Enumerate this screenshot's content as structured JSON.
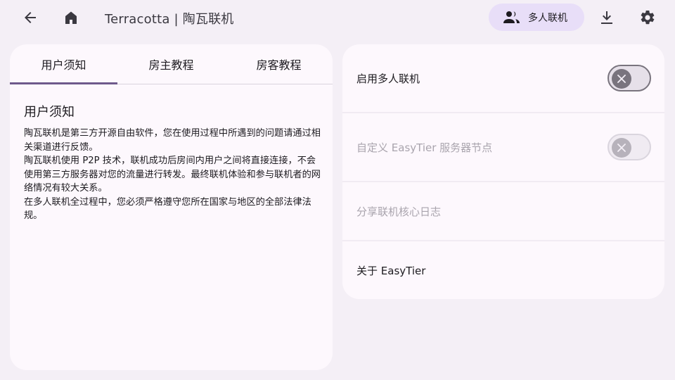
{
  "app": {
    "title": "Terracotta | 陶瓦联机"
  },
  "toolbar": {
    "back_icon": "arrow-left-icon",
    "home_icon": "home-icon",
    "multiplayer_chip_label": "多人联机",
    "multiplayer_chip_icon": "people-icon",
    "download_icon": "download-icon",
    "settings_icon": "gear-icon"
  },
  "tabs": [
    {
      "label": "用户须知",
      "active": true
    },
    {
      "label": "房主教程",
      "active": false
    },
    {
      "label": "房客教程",
      "active": false
    }
  ],
  "notice": {
    "title": "用户须知",
    "paragraphs": [
      "陶瓦联机是第三方开源自由软件，您在使用过程中所遇到的问题请通过相关渠道进行反馈。",
      "陶瓦联机使用 P2P 技术，联机成功后房间内用户之间将直接连接，不会使用第三方服务器对您的流量进行转发。最终联机体验和参与联机者的网络情况有较大关系。",
      "在多人联机全过程中，您必须严格遵守您所在国家与地区的全部法律法规。"
    ]
  },
  "settings": [
    {
      "label": "启用多人联机",
      "type": "switch",
      "on": false,
      "enabled": true
    },
    {
      "label": "自定义 EasyTier 服务器节点",
      "type": "switch",
      "on": false,
      "enabled": false
    },
    {
      "label": "分享联机核心日志",
      "type": "action",
      "enabled": false
    },
    {
      "label": "关于 EasyTier",
      "type": "action",
      "enabled": true
    }
  ],
  "colors": {
    "background": "#f4eff6",
    "card": "#fdf8fd",
    "accent": "#6e5a8c",
    "chip": "#e8def8"
  }
}
